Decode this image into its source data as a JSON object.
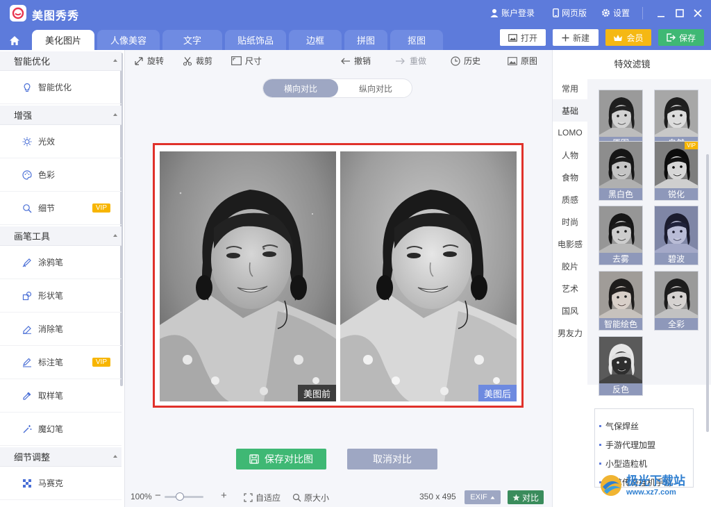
{
  "app": {
    "title": "美图秀秀"
  },
  "titlebar": {
    "account": "账户登录",
    "web": "网页版",
    "settings": "设置"
  },
  "tabs": [
    "美化图片",
    "人像美容",
    "文字",
    "贴纸饰品",
    "边框",
    "拼图",
    "抠图"
  ],
  "top_buttons": {
    "open": "打开",
    "new": "新建",
    "vip": "会员",
    "save": "保存"
  },
  "left_panel": {
    "sections": [
      {
        "title": "智能优化",
        "items": [
          {
            "label": "智能优化",
            "icon": "bulb-icon"
          }
        ]
      },
      {
        "title": "增强",
        "items": [
          {
            "label": "光效",
            "icon": "sun-icon"
          },
          {
            "label": "色彩",
            "icon": "palette-icon"
          },
          {
            "label": "细节",
            "icon": "magnifier-icon",
            "vip": "VIP"
          }
        ]
      },
      {
        "title": "画笔工具",
        "items": [
          {
            "label": "涂鸦笔",
            "icon": "doodle-pen-icon"
          },
          {
            "label": "形状笔",
            "icon": "shape-pen-icon"
          },
          {
            "label": "消除笔",
            "icon": "eraser-pen-icon"
          },
          {
            "label": "标注笔",
            "icon": "marker-pen-icon",
            "vip": "VIP"
          },
          {
            "label": "取样笔",
            "icon": "dropper-icon"
          },
          {
            "label": "魔幻笔",
            "icon": "magic-wand-icon"
          }
        ]
      },
      {
        "title": "细节调整",
        "items": [
          {
            "label": "马赛克",
            "icon": "mosaic-icon"
          }
        ]
      }
    ]
  },
  "toolbar": {
    "rotate": "旋转",
    "crop": "裁剪",
    "size": "尺寸",
    "undo": "撤销",
    "redo": "重做",
    "history": "历史",
    "original": "原图"
  },
  "compare": {
    "horizontal": "横向对比",
    "vertical": "纵向对比",
    "before_label": "美图前",
    "after_label": "美图后"
  },
  "buttons": {
    "save_compare": "保存对比图",
    "cancel_compare": "取消对比"
  },
  "status": {
    "zoom": "100%",
    "zoom_level": 0.4,
    "fit": "自适应",
    "actual": "原大小",
    "dimensions": "350 x 495",
    "exif": "EXIF",
    "compare": "对比"
  },
  "right_panel": {
    "title": "特效滤镜",
    "categories": [
      "常用",
      "基础",
      "LOMO",
      "人物",
      "食物",
      "质感",
      "时尚",
      "电影感",
      "胶片",
      "艺术",
      "国风",
      "男友力"
    ],
    "active_category": "基础",
    "filters": [
      {
        "label": "原图"
      },
      {
        "label": "自然"
      },
      {
        "label": "黑白色"
      },
      {
        "label": "锐化",
        "vip": "VIP"
      },
      {
        "label": "去雾"
      },
      {
        "label": "碧波"
      },
      {
        "label": "智能绘色"
      },
      {
        "label": "全彩"
      },
      {
        "label": "反色"
      }
    ],
    "ad_items": [
      "气保焊丝",
      "手游代理加盟",
      "小型造粒机",
      "至尊传奇挂机手游"
    ]
  },
  "watermark": {
    "line1": "极光下载站",
    "line2": "www.xz7.com"
  },
  "colors": {
    "brand": "#5d7bdb",
    "frame": "#e0312a",
    "vip": "#f7b500",
    "save": "#3fb874"
  }
}
